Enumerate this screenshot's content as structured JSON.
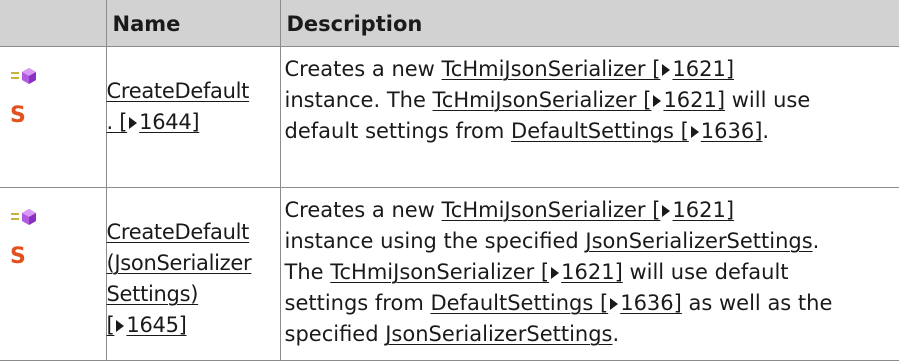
{
  "table": {
    "header": {
      "icon_col": "",
      "name": "Name",
      "description": "Description"
    },
    "rows": [
      {
        "icons": [
          "method-icon",
          "static-icon"
        ],
        "name_lines": [
          {
            "text": "CreateDefault",
            "link": true
          },
          {
            "text": ". [",
            "link": true,
            "arrow": true,
            "after": "1644]"
          }
        ],
        "desc": {
          "l1_a": "Creates a new ",
          "l1_link": "TcHmiJsonSerializer [",
          "l1_num": "1621]",
          "l2_a": "instance. The ",
          "l2_link": "TcHmiJsonSerializer [",
          "l2_num": "1621]",
          "l2_b": " will use",
          "l3_a": "default settings from ",
          "l3_link": "DefaultSettings [",
          "l3_num": "1636]",
          "l3_b": "."
        }
      },
      {
        "icons": [
          "method-icon",
          "static-icon"
        ],
        "name_lines": [
          "CreateDefault",
          "(JsonSerializer",
          "Settings)",
          "[",
          "1645]"
        ],
        "desc": {
          "l1_a": "Creates a new ",
          "l1_link": "TcHmiJsonSerializer [",
          "l1_num": "1621]",
          "l2_a": "instance using the specified ",
          "l2_link": "JsonSerializerSettings",
          "l2_b": ".",
          "l3_a": "The ",
          "l3_link": "TcHmiJsonSerializer [",
          "l3_num": "1621]",
          "l3_b": " will use default",
          "l4_a": "settings from ",
          "l4_link": "DefaultSettings [",
          "l4_num": "1636]",
          "l4_b": " as well as the",
          "l5_a": "specified ",
          "l5_link": "JsonSerializerSettings",
          "l5_b": "."
        }
      }
    ]
  },
  "colors": {
    "header_bg": "#d2d2d2",
    "border": "#8c8c8c",
    "static_icon": "#e2501e",
    "method_icon": "#9b3fd0"
  }
}
